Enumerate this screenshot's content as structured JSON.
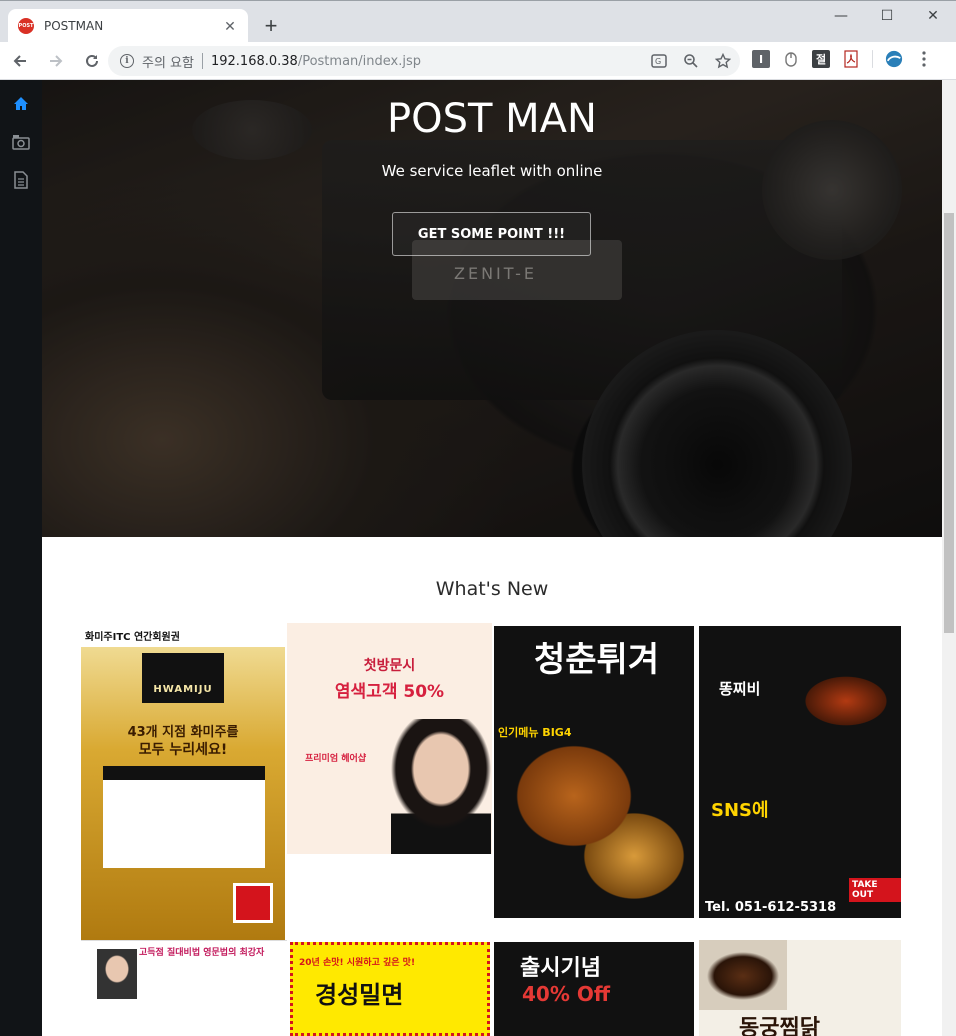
{
  "browser": {
    "tab_title": "POSTMAN",
    "favicon_text": "POST",
    "security_label": "주의 요함",
    "url_host": "192.168.0.38",
    "url_path": "/Postman/index.jsp",
    "ext_labels": [
      "I",
      "절"
    ]
  },
  "sidebar": {
    "items": [
      {
        "icon": "home-icon",
        "color": "#1e90ff"
      },
      {
        "icon": "camera-icon",
        "color": "#8a8f94"
      },
      {
        "icon": "document-icon",
        "color": "#8a8f94"
      }
    ]
  },
  "hero": {
    "camera_label": "ZENIT-E",
    "title": "POST MAN",
    "subtitle": "We service leaflet with online",
    "cta_label": "GET SOME POINT !!!"
  },
  "whats_new": {
    "title": "What's New",
    "leaflets": [
      {
        "header": "화미주ITC 연간회원권",
        "brand": "HWAMIJU",
        "headline": "43개 지점 화미주를",
        "headline2": "모두 누리세요!"
      },
      {
        "header": "첫방문시",
        "headline": "염색고객 50%",
        "sub": "프리미엄 헤어샵"
      },
      {
        "headline": "청춘튀겨",
        "badge": "인기메뉴 BIG4"
      },
      {
        "headline": "똥찌비",
        "sns": "SNS에",
        "phone": "Tel. 051-612-5318",
        "takeout": "TAKE OUT"
      },
      {
        "headline": "고득점 질대비법 영문법의 최강자"
      },
      {
        "headline": "경성밀면",
        "tag": "20년 손맛! 시원하고 깊은 맛!"
      },
      {
        "headline": "출시기념",
        "sub": "40% Off"
      },
      {
        "headline": "동궁찜닭"
      }
    ]
  }
}
